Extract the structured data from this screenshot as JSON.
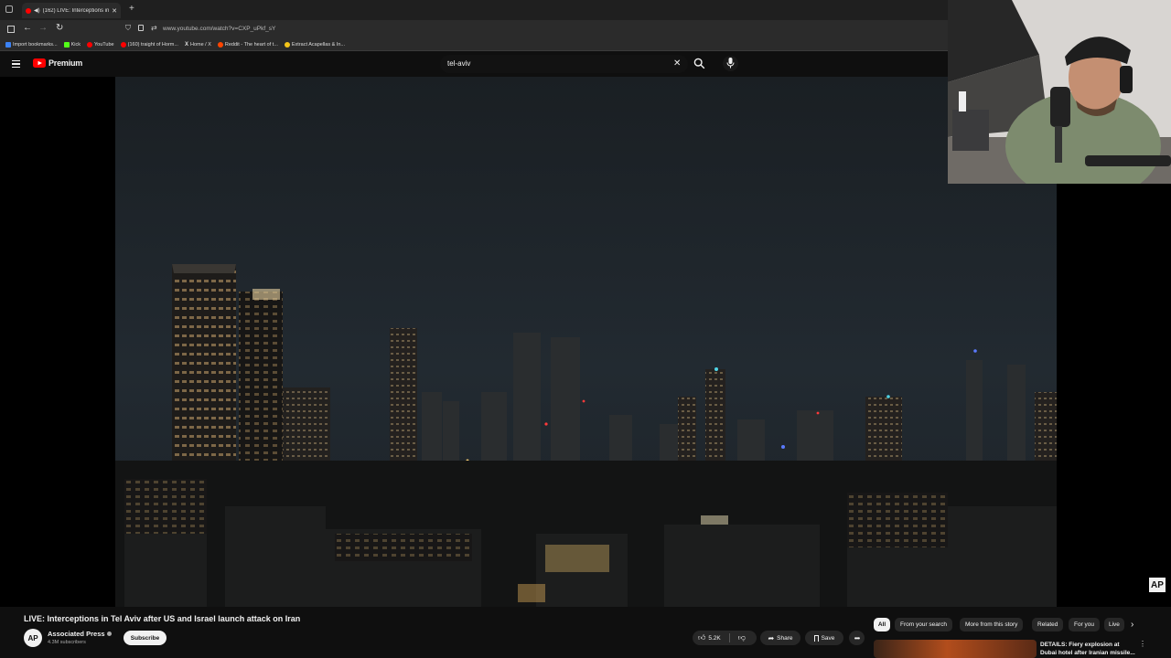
{
  "browser": {
    "tab_title": "(162) LIVE: Interceptions in",
    "url": "www.youtube.com/watch?v=CXP_uPkf_sY",
    "bookmarks": [
      {
        "label": "Import bookmarks...",
        "color": "#3b82f6"
      },
      {
        "label": "Kick",
        "color": "#53fc18"
      },
      {
        "label": "YouTube",
        "color": "#ff0000"
      },
      {
        "label": "(160) traight of Horm...",
        "color": "#ff0000"
      },
      {
        "label": "Home / X",
        "color": "#ffffff"
      },
      {
        "label": "Reddit - The heart of t...",
        "color": "#ff4500"
      },
      {
        "label": "Extract Acapellas & In...",
        "color": "#f5c518"
      }
    ]
  },
  "header": {
    "logo_text": "Premium",
    "search_value": "tel-aviv"
  },
  "video": {
    "title": "LIVE: Interceptions in Tel Aviv after US and Israel launch attack on Iran",
    "watermark": "AP"
  },
  "channel": {
    "avatar_text": "AP",
    "name": "Associated Press",
    "subscribers": "4.3M subscribers",
    "subscribe_label": "Subscribe"
  },
  "actions": {
    "likes": "5.2K",
    "share_label": "Share",
    "save_label": "Save"
  },
  "chips": [
    "All",
    "From your search",
    "More from this story",
    "Related",
    "For you",
    "Live"
  ],
  "recommendation": {
    "title_line1": "DETAILS: Fiery explosion at",
    "title_line2": "Dubai hotel after Iranian missile..."
  },
  "colors": {
    "accent": "#ff0000",
    "background": "#0f0f0f",
    "chip_bg": "#272727"
  }
}
